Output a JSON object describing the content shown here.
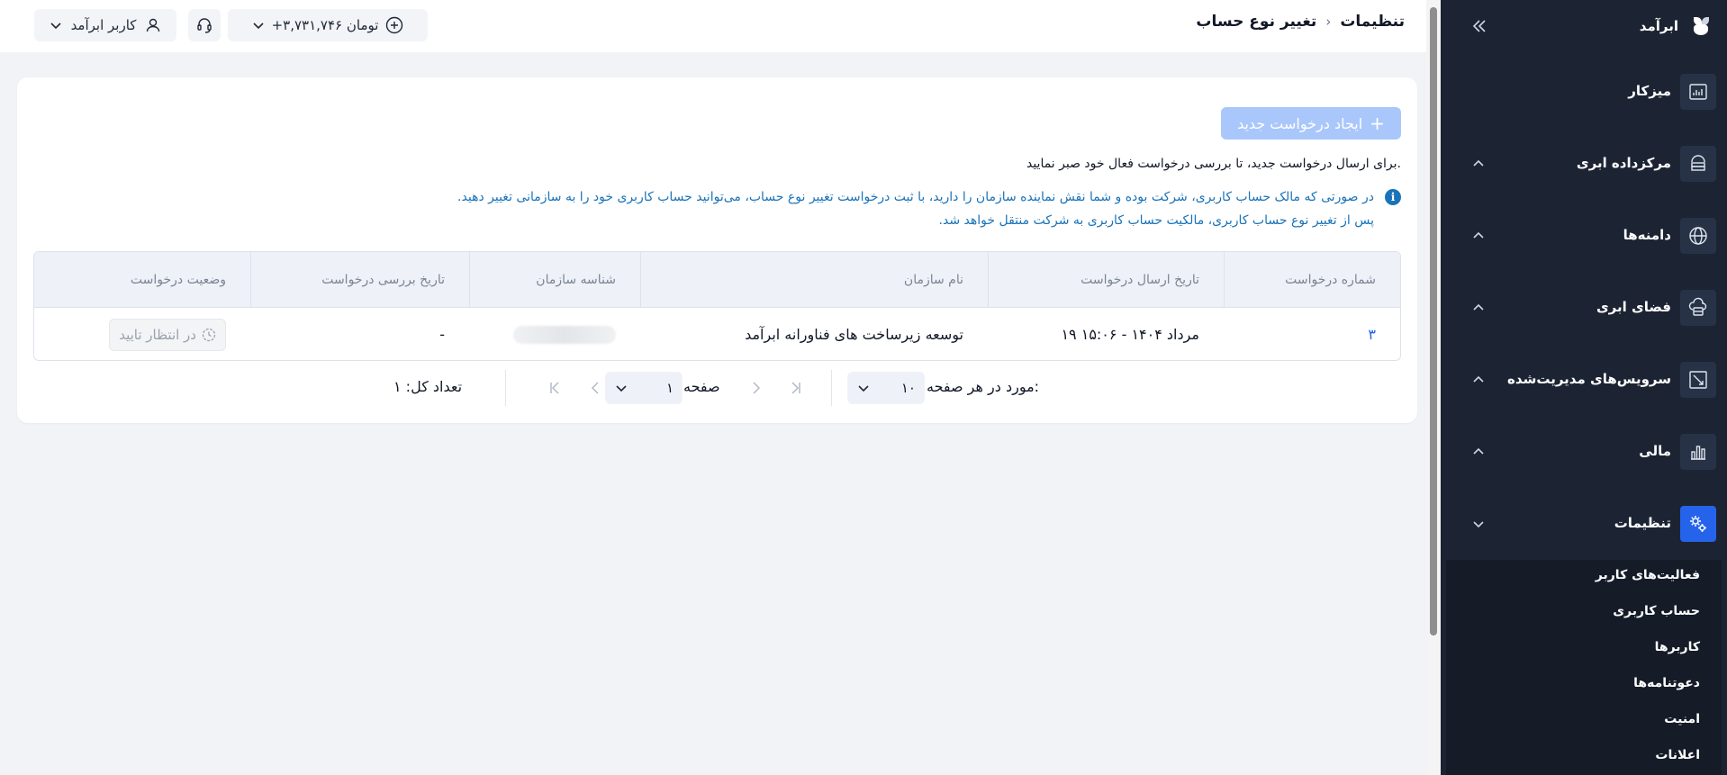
{
  "sidebar": {
    "brand": "ابرآمد",
    "items": [
      {
        "label": "میزکار",
        "icon": "dashboard-icon"
      },
      {
        "label": "مرکزداده ابری",
        "icon": "datacenter-icon"
      },
      {
        "label": "دامنه‌ها",
        "icon": "globe-icon"
      },
      {
        "label": "فضای ابری",
        "icon": "cloud-space-icon"
      },
      {
        "label": "سرویس‌های مدیریت‌شده",
        "icon": "managed-services-icon"
      },
      {
        "label": "مالی",
        "icon": "finance-icon"
      },
      {
        "label": "تنظیمات",
        "icon": "settings-icon"
      }
    ],
    "settings_subitems": [
      "فعالیت‌های کاربر",
      "حساب کاربری",
      "کاربرها",
      "دعوتنامه‌ها",
      "امنیت",
      "اعلانات"
    ]
  },
  "header": {
    "breadcrumb_root": "تنظیمات",
    "breadcrumb_current": "تغییر نوع حساب",
    "balance": "+۳,۷۳۱,۷۴۶ تومان",
    "user": "کاربر ابرآمد"
  },
  "page": {
    "new_request_button": "ایجاد درخواست جدید",
    "notice": "برای ارسال درخواست جدید، تا بررسی درخواست فعال خود صبر نمایید.",
    "info_line1": "در صورتی که مالک حساب کاربری، شرکت بوده و شما نقش نماینده سازمان را دارید، با ثبت درخواست تغییر نوع حساب، می‌توانید حساب کاربری خود را به سازمانی تغییر دهید.",
    "info_line2": "پس از تغییر نوع حساب کاربری، مالکیت حساب کاربری به شرکت منتقل خواهد شد."
  },
  "table": {
    "columns": [
      "شماره درخواست",
      "تاریخ ارسال درخواست",
      "نام سازمان",
      "شناسه سازمان",
      "تاریخ بررسی درخواست",
      "وضعیت درخواست"
    ],
    "rows": [
      {
        "number": "۳",
        "sent_date": "۱۹ مرداد ۱۴۰۴ - ۱۵:۰۶",
        "org_name": "توسعه زیرساخت های فناورانه ابرآمد",
        "org_id": "",
        "review_date": "-",
        "status": "در انتظار تایید"
      }
    ]
  },
  "pagination": {
    "per_page_label": "مورد در هر صفحه:",
    "per_page_value": "۱۰",
    "page_label": "صفحه",
    "page_value": "۱",
    "total_label": "تعداد کل: ۱"
  },
  "colors": {
    "sidebar_bg": "#1c2433",
    "accent": "#2563eb",
    "info_text": "#1a73b8",
    "disabled_button": "#a9c7fb"
  }
}
